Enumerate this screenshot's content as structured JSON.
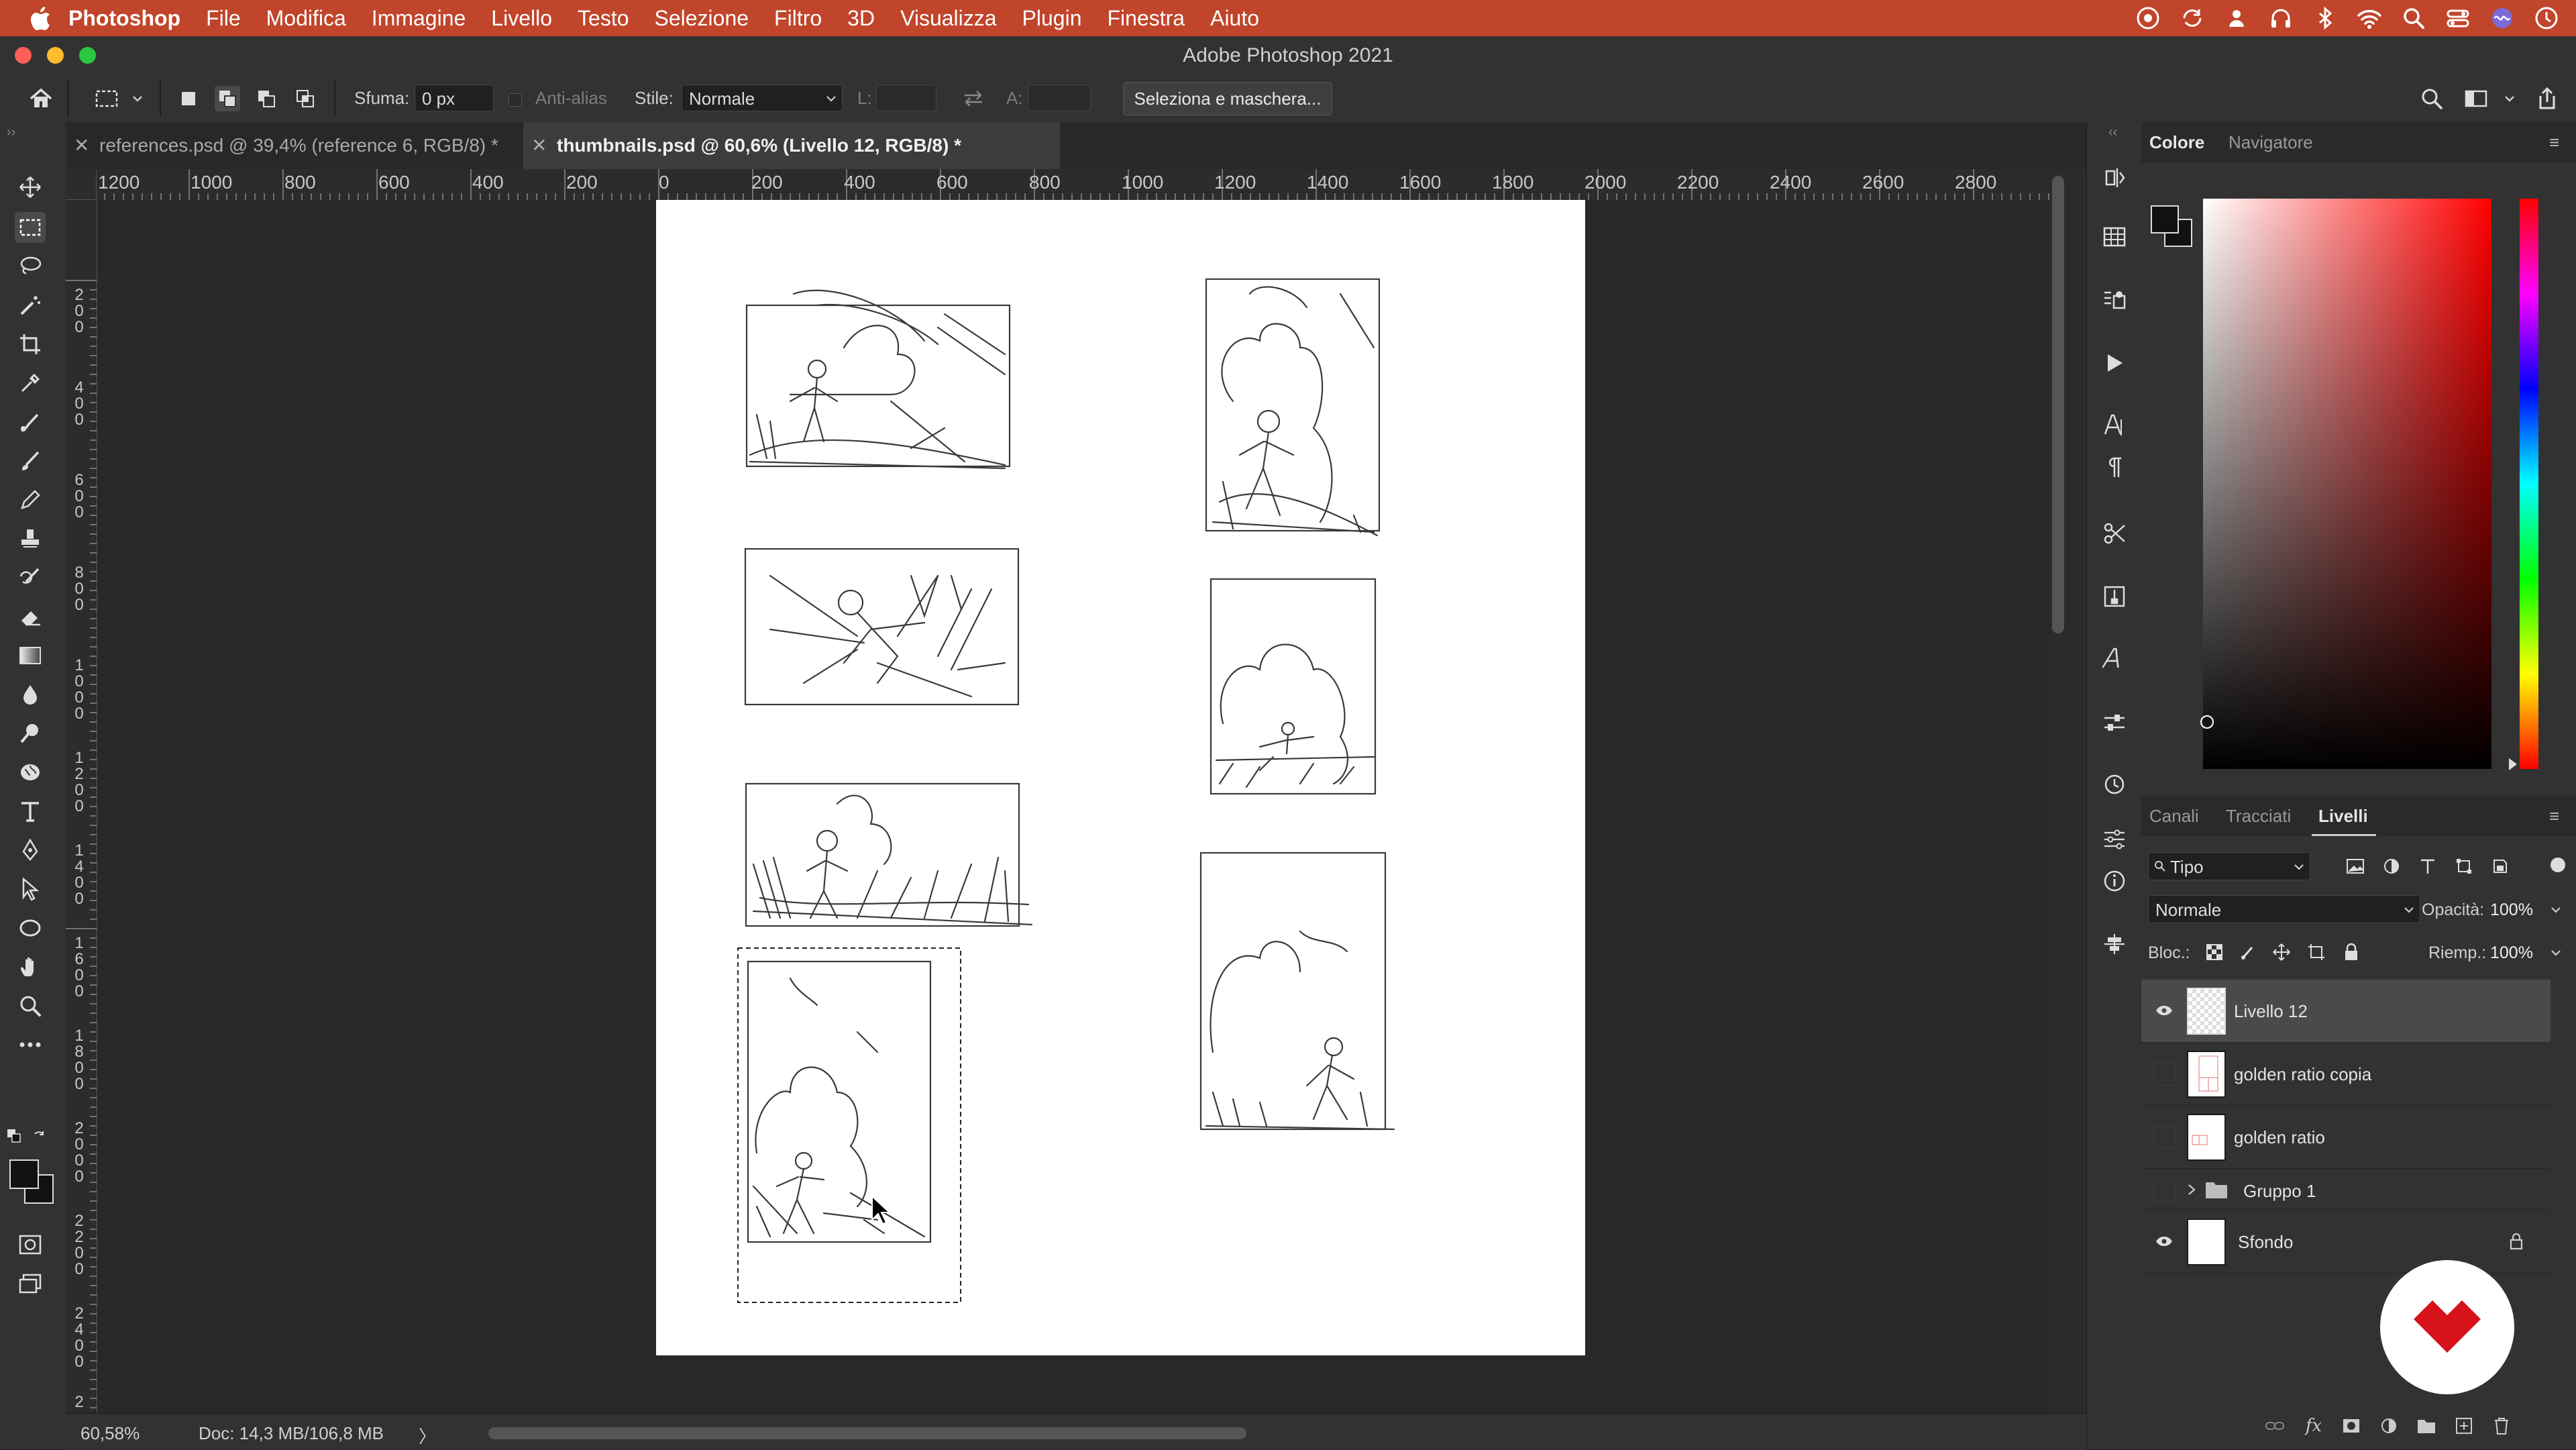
{
  "menubar": {
    "app_name": "Photoshop",
    "items": [
      "File",
      "Modifica",
      "Immagine",
      "Livello",
      "Testo",
      "Selezione",
      "Filtro",
      "3D",
      "Visualizza",
      "Plugin",
      "Finestra",
      "Aiuto"
    ],
    "status_icons": [
      "creative-cloud-icon",
      "sync-icon",
      "user-icon",
      "headphones-icon",
      "bluetooth-icon",
      "wifi-icon",
      "spotlight-icon",
      "control-center-icon",
      "siri-icon",
      "clock-icon"
    ],
    "accent_color": "#c0452b"
  },
  "window": {
    "title": "Adobe Photoshop 2021"
  },
  "options": {
    "feather_label": "Sfuma:",
    "feather_value": "0 px",
    "antialias_label": "Anti-alias",
    "style_label": "Stile:",
    "style_value": "Normale",
    "width_label": "L:",
    "height_label": "A:",
    "select_mask_button": "Seleziona e maschera..."
  },
  "tabs": [
    {
      "label": "references.psd @ 39,4% (reference  6, RGB/8) *",
      "active": false
    },
    {
      "label": "thumbnails.psd @ 60,6% (Livello 12, RGB/8) *",
      "active": true
    }
  ],
  "ruler_top": [
    "1200",
    "1000",
    "800",
    "600",
    "400",
    "200",
    "0",
    "200",
    "400",
    "600",
    "800",
    "1000",
    "1200",
    "1400",
    "1600",
    "1800",
    "2000",
    "2200",
    "2400",
    "2600",
    "2800"
  ],
  "ruler_left": [
    "2\n0\n0",
    "4\n0\n0",
    "6\n0\n0",
    "8\n0\n0",
    "1\n0\n0\n0",
    "1\n2\n0\n0",
    "1\n4\n0\n0",
    "1\n6\n0\n0",
    "1\n8\n0\n0",
    "2\n0\n0\n0",
    "2\n2\n0\n0",
    "2\n4\n0\n0",
    "2"
  ],
  "status": {
    "zoom": "60,58%",
    "doc_size": "Doc: 14,3 MB/106,8 MB",
    "arrow": "〉"
  },
  "color_panel": {
    "tabs": [
      "Colore",
      "Navigatore"
    ],
    "active_tab": "Colore",
    "hue_color": "#ff0000"
  },
  "layers_panel": {
    "tabs": [
      "Canali",
      "Tracciati",
      "Livelli"
    ],
    "active_tab": "Livelli",
    "filter_label": "Tipo",
    "blend_mode": "Normale",
    "opacity_label": "Opacità:",
    "opacity_value": "100%",
    "lock_label": "Bloc.:",
    "fill_label": "Riemp.:",
    "fill_value": "100%",
    "layers": [
      {
        "name": "Livello 12",
        "visible": true,
        "selected": true,
        "kind": "pixel"
      },
      {
        "name": "golden ratio copia",
        "visible": false,
        "selected": false,
        "kind": "pixel"
      },
      {
        "name": "golden ratio",
        "visible": false,
        "selected": false,
        "kind": "pixel"
      },
      {
        "name": "Gruppo 1",
        "visible": false,
        "selected": false,
        "kind": "group"
      },
      {
        "name": "Sfondo",
        "visible": true,
        "selected": false,
        "kind": "background",
        "locked": true
      }
    ]
  },
  "brand_badge_color": "#d6121a"
}
